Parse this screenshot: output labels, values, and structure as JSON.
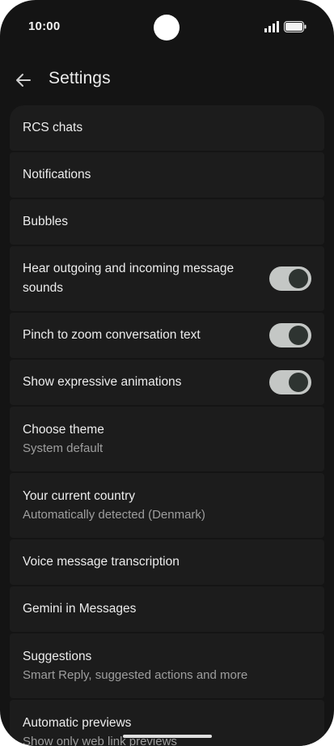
{
  "status": {
    "time": "10:00"
  },
  "app_bar": {
    "title": "Settings"
  },
  "items": [
    {
      "label": "RCS chats"
    },
    {
      "label": "Notifications"
    },
    {
      "label": "Bubbles"
    },
    {
      "label": "Hear outgoing and incoming message sounds",
      "toggle": true
    },
    {
      "label": "Pinch to zoom conversation text",
      "toggle": true
    },
    {
      "label": "Show expressive animations",
      "toggle": true
    },
    {
      "label": "Choose theme",
      "sub": "System default"
    },
    {
      "label": "Your current country",
      "sub": "Automatically detected (Denmark)"
    },
    {
      "label": "Voice message transcription"
    },
    {
      "label": "Gemini in Messages"
    },
    {
      "label": "Suggestions",
      "sub": "Smart Reply, suggested actions and more"
    },
    {
      "label": "Automatic previews",
      "sub": "Show only web link previews"
    }
  ],
  "icons": {
    "back": "arrow-back-icon",
    "signal": "signal-icon",
    "battery": "battery-icon"
  },
  "colors": {
    "background": "#141414",
    "card": "#1c1c1c",
    "text_primary": "#ececec",
    "text_secondary": "#9e9e9e",
    "toggle_track": "#c4c7c5",
    "toggle_thumb": "#2e3431"
  }
}
